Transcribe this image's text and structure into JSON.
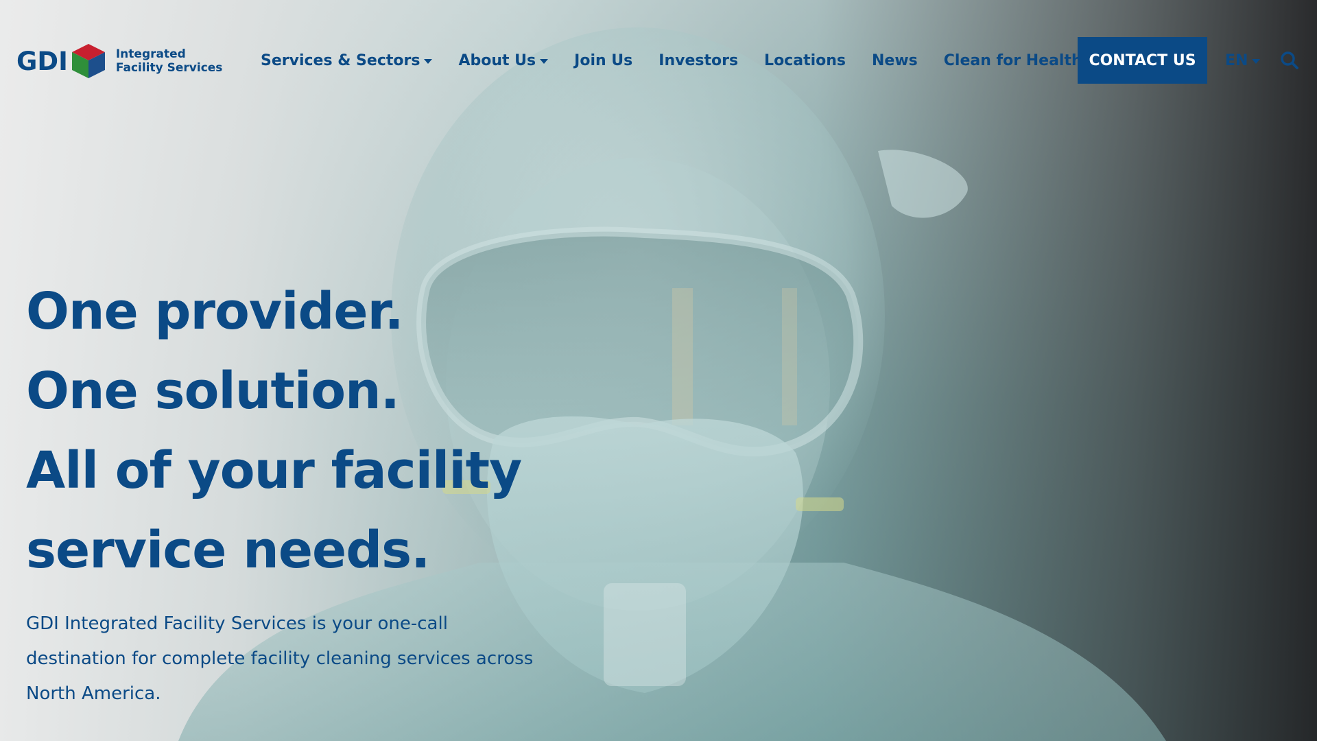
{
  "brand": {
    "logo_text": "GDI",
    "tagline_line1": "Integrated",
    "tagline_line2": "Facility Services",
    "colors": {
      "primary": "#0b4a86",
      "cube_red": "#c8202f",
      "cube_green": "#2f8f3a",
      "cube_blue": "#1d4f8c"
    }
  },
  "nav": {
    "items": [
      {
        "label": "Services & Sectors",
        "dropdown": true
      },
      {
        "label": "About Us",
        "dropdown": true
      },
      {
        "label": "Join Us",
        "dropdown": false
      },
      {
        "label": "Investors",
        "dropdown": false
      },
      {
        "label": "Locations",
        "dropdown": false
      },
      {
        "label": "News",
        "dropdown": false
      },
      {
        "label": "Clean for Health",
        "dropdown": false,
        "external": true
      }
    ],
    "contact_label": "CONTACT US",
    "language": "EN",
    "search_icon": "search-icon"
  },
  "hero": {
    "headline": [
      "One provider.",
      "One solution.",
      "All of your facility",
      "service needs."
    ],
    "intro": "GDI Integrated Facility Services is your one-call destination for complete facility cleaning services across North America.",
    "background": "worker-in-protective-suit-goggles-and-respirator"
  }
}
